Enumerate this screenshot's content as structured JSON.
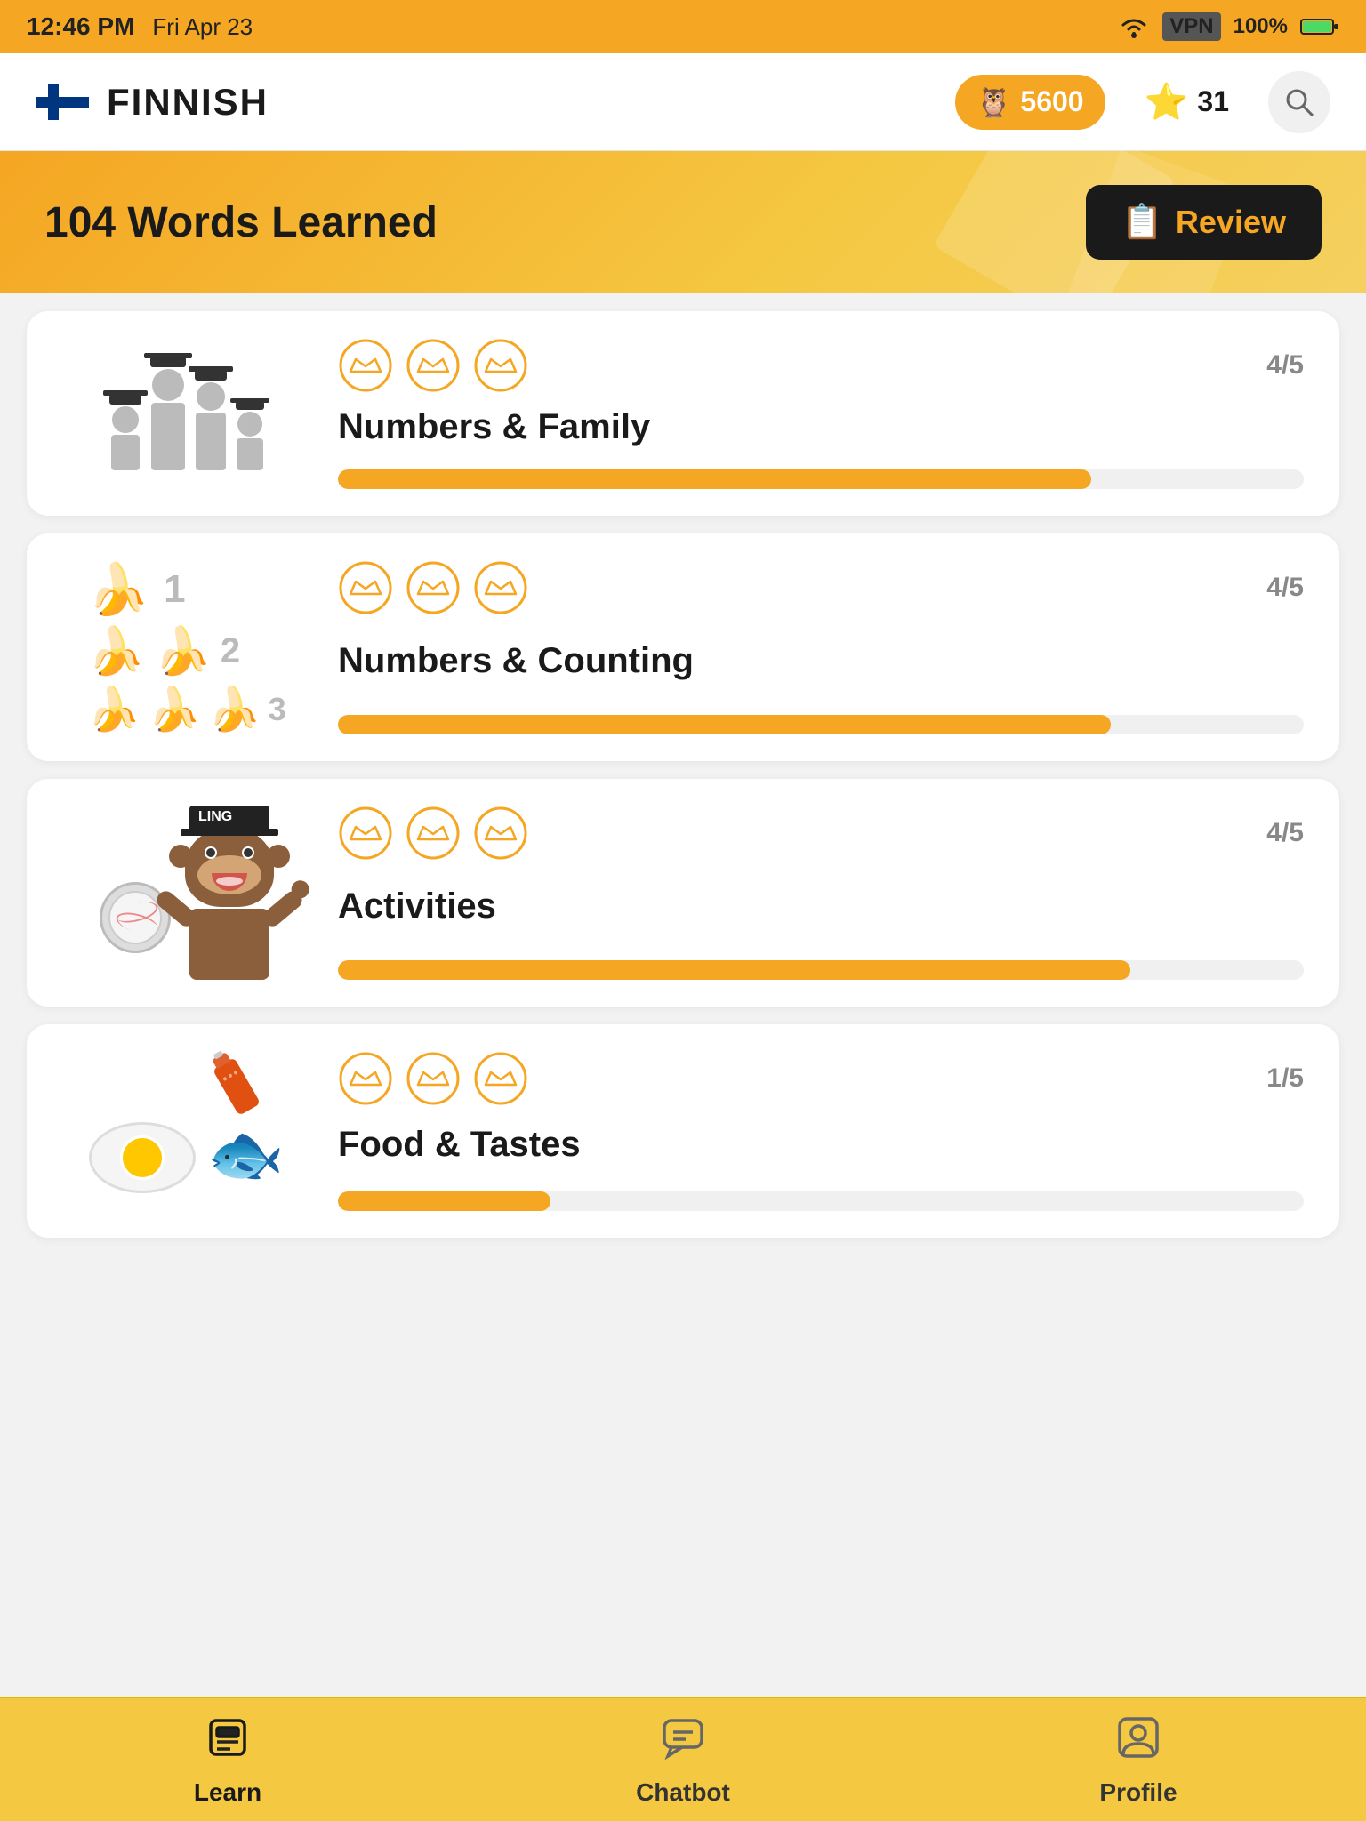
{
  "statusBar": {
    "time": "12:46 PM",
    "date": "Fri Apr 23",
    "vpn": "VPN",
    "battery": "100%"
  },
  "topNav": {
    "language": "FINNISH",
    "coins": "5600",
    "stars": "31"
  },
  "banner": {
    "title": "104 Words Learned",
    "reviewButton": "Review"
  },
  "lessons": [
    {
      "title": "Numbers & Family",
      "score": "4/5",
      "progressPercent": 78,
      "crowns": 3
    },
    {
      "title": "Numbers & Counting",
      "score": "4/5",
      "progressPercent": 80,
      "crowns": 3
    },
    {
      "title": "Activities",
      "score": "4/5",
      "progressPercent": 82,
      "crowns": 3
    },
    {
      "title": "Food & Tastes",
      "score": "1/5",
      "progressPercent": 22,
      "crowns": 3
    }
  ],
  "bottomNav": {
    "items": [
      {
        "id": "learn",
        "label": "Learn",
        "active": true
      },
      {
        "id": "chatbot",
        "label": "Chatbot",
        "active": false
      },
      {
        "id": "profile",
        "label": "Profile",
        "active": false
      }
    ]
  }
}
